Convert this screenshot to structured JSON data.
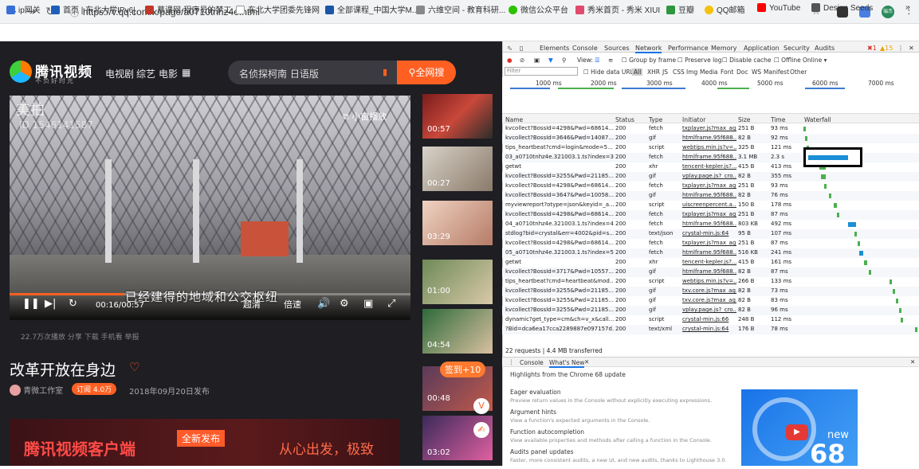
{
  "browser": {
    "url": "https://v.qq.com/x/page/a0710tnhz4e.html",
    "bookmarks": [
      "ip网关",
      "首页 | 东北大学IPv6|",
      "慕课网-程序员的梦工...",
      "东北大学团委先锋网",
      "全部课程_中国大学M...",
      "六维空间 - 教育科研...",
      "微信公众平台",
      "秀米首页 - 秀米 XIUI",
      "豆瓣",
      "QQ邮箱",
      "YouTube",
      "Design Seeds"
    ],
    "profile": "瑞杰"
  },
  "site": {
    "brand": "腾讯视频",
    "slogan": "不负好时光",
    "nav": [
      "电视剧",
      "综艺",
      "电影"
    ],
    "search_text": "名侦探柯南 日语版",
    "search_btn": "全网搜",
    "video": {
      "watermark": "美拍",
      "watermark_id": "ID 1546141587",
      "mini": "小窗播放",
      "subtitle": "已经建得的地域和公交枢纽",
      "time": "00:16/00:57",
      "sd": "超清",
      "speed": "倍速"
    },
    "meta": "22.7万次播放  分享  下载  手机看  举报",
    "title": "改革开放在身边",
    "uploader": "青微工作室",
    "sub": "订阅 4.0万",
    "date": "2018年09月20日发布",
    "banner": "腾讯视频客户端",
    "banner_badge": "全新发布",
    "banner2": "从心出发，极致",
    "thumbs": [
      "00:57",
      "00:27",
      "03:29",
      "01:00",
      "04:54",
      "00:48",
      "03:02"
    ],
    "sign": "签到+10"
  },
  "devtools": {
    "tabs": [
      "Elements",
      "Console",
      "Sources",
      "Network",
      "Performance",
      "Memory",
      "Application",
      "Security",
      "Audits"
    ],
    "errors": "1",
    "warnings": "15",
    "toolbar": [
      "View:",
      "Group by frame",
      "Preserve log",
      "Disable cache",
      "Offline",
      "Online"
    ],
    "filter_placeholder": "Filter",
    "hide": "Hide data URLs",
    "types": [
      "All",
      "XHR",
      "JS",
      "CSS",
      "Img",
      "Media",
      "Font",
      "Doc",
      "WS",
      "Manifest",
      "Other"
    ],
    "ticks": [
      "1000 ms",
      "2000 ms",
      "3000 ms",
      "4000 ms",
      "5000 ms",
      "6000 ms",
      "7000 ms"
    ],
    "headers": [
      "Name",
      "Status",
      "Type",
      "Initiator",
      "Size",
      "Time",
      "Waterfall"
    ],
    "rows": [
      [
        "kvcollect?BossId=4298&Pwd=68614...",
        "200",
        "fetch",
        "txplayer.js?max_ag...",
        "251 B",
        "93 ms"
      ],
      [
        "kvcollect?BossId=3646&Pwd=14087...",
        "200",
        "gif",
        "htmlframe.95f688...",
        "82 B",
        "92 ms"
      ],
      [
        "tips_heartbeat?cmd=login&mode=5...",
        "200",
        "script",
        "webtips.min.js?v=...",
        "325 B",
        "121 ms"
      ],
      [
        "03_a0710tnhz4e.321003.1.ts?index=3...",
        "200",
        "fetch",
        "htmlframe.95f688...",
        "3.1 MB",
        "2.3 s"
      ],
      [
        "getwt",
        "200",
        "xhr",
        "tencent-kepler.js?...",
        "415 B",
        "413 ms"
      ],
      [
        "kvcollect?BossId=3255&Pwd=21185...",
        "200",
        "gif",
        "vplay.page.js?_cro...",
        "82 B",
        "355 ms"
      ],
      [
        "kvcollect?BossId=4298&Pwd=68614...",
        "200",
        "fetch",
        "txplayer.js?max_ag...",
        "251 B",
        "93 ms"
      ],
      [
        "kvcollect?BossId=3647&Pwd=10058...",
        "200",
        "gif",
        "htmlframe.95f688...",
        "82 B",
        "76 ms"
      ],
      [
        "myviewreport?otype=json&keyid=_a...",
        "200",
        "script",
        "uiscreenpercent.a...",
        "150 B",
        "178 ms"
      ],
      [
        "kvcollect?BossId=4298&Pwd=68614...",
        "200",
        "fetch",
        "txplayer.js?max_ag...",
        "251 B",
        "87 ms"
      ],
      [
        "04_a0710tnhz4e.321003.1.ts?index=4...",
        "200",
        "fetch",
        "htmlframe.95f688...",
        "803 KB",
        "492 ms"
      ],
      [
        "stdlog?bid=crystal&err=4002&pid=s...",
        "200",
        "text/json",
        "crystal-min.js:64",
        "95 B",
        "107 ms"
      ],
      [
        "kvcollect?BossId=4298&Pwd=68614...",
        "200",
        "fetch",
        "txplayer.js?max_ag...",
        "251 B",
        "87 ms"
      ],
      [
        "05_a0710tnhz4e.321003.1.ts?index=5...",
        "200",
        "fetch",
        "htmlframe.95f688...",
        "516 KB",
        "241 ms"
      ],
      [
        "getwt",
        "200",
        "xhr",
        "tencent-kepler.js?...",
        "415 B",
        "161 ms"
      ],
      [
        "kvcollect?BossId=3717&Pwd=10557...",
        "200",
        "gif",
        "htmlframe.95f688...",
        "82 B",
        "87 ms"
      ],
      [
        "tips_heartbeat?cmd=heartbeat&mod...",
        "200",
        "script",
        "webtips.min.js?v=...",
        "266 B",
        "133 ms"
      ],
      [
        "kvcollect?BossId=3255&Pwd=21185...",
        "200",
        "gif",
        "txv.core.js?max_ag...",
        "82 B",
        "73 ms"
      ],
      [
        "kvcollect?BossId=3255&Pwd=21185...",
        "200",
        "gif",
        "txv.core.js?max_ag...",
        "82 B",
        "83 ms"
      ],
      [
        "kvcollect?BossId=3255&Pwd=21185...",
        "200",
        "gif",
        "vplay.page.js?_cro...",
        "82 B",
        "96 ms"
      ],
      [
        "dynamic?get_type=cm&ch=v_x&call...",
        "200",
        "script",
        "crystal-min.js:66",
        "248 B",
        "112 ms"
      ],
      [
        "?Bid=dca6ea17cca2289887e097157d...",
        "200",
        "text/xml",
        "crystal-min.js:64",
        "176 B",
        "78 ms"
      ]
    ],
    "status": "22 requests | 4.4 MB transferred",
    "drawer_tabs": [
      "Console",
      "What's New"
    ],
    "wn_title": "Highlights from the Chrome 68 update",
    "wn_items": [
      [
        "Eager evaluation",
        "Preview return values in the Console without explicitly executing expressions."
      ],
      [
        "Argument hints",
        "View a function's expected arguments in the Console."
      ],
      [
        "Function autocompletion",
        "View available properties and methods after calling a function in the Console."
      ],
      [
        "Audits panel updates",
        "Faster, more consistent audits, a new UI, and new audits, thanks to Lighthouse 3.0."
      ]
    ],
    "wn_new": "new",
    "wn_num": "68"
  }
}
